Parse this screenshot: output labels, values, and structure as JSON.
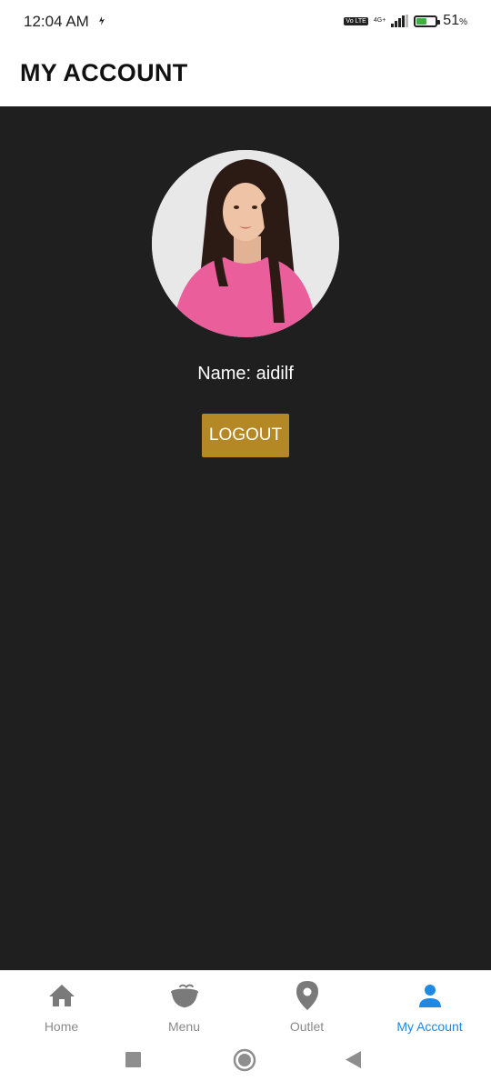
{
  "status_bar": {
    "time": "12:04 AM",
    "volte": "Vo LTE",
    "network": "4G+",
    "battery_percent": "51",
    "battery_unit": "%"
  },
  "header": {
    "title": "MY ACCOUNT"
  },
  "profile": {
    "name_text": "Name: aidilf",
    "logout_label": "LOGOUT"
  },
  "bottom_nav": {
    "items": [
      {
        "label": "Home",
        "icon": "home-icon"
      },
      {
        "label": "Menu",
        "icon": "coffee-cup-icon"
      },
      {
        "label": "Outlet",
        "icon": "location-pin-icon"
      },
      {
        "label": "My Account",
        "icon": "person-icon"
      }
    ],
    "active_index": 3
  },
  "colors": {
    "content_bg": "#1f1f1f",
    "logout_bg": "#b58826",
    "active_nav": "#1e88e5",
    "inactive_nav": "#8a8a8a"
  }
}
